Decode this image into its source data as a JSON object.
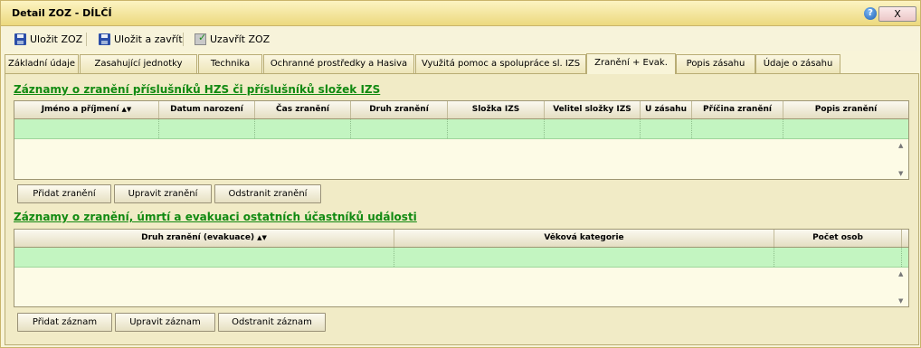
{
  "window": {
    "title": "Detail ZOZ - DÍLČÍ",
    "help_glyph": "?",
    "close_label": "X"
  },
  "toolbar": {
    "save_label": "Uložit ZOZ",
    "save_close_label": "Uložit a zavřít",
    "close_zoz_label": "Uzavřít ZOZ"
  },
  "tabs": [
    {
      "label": "Základní údaje"
    },
    {
      "label": "Zasahující jednotky"
    },
    {
      "label": "Technika"
    },
    {
      "label": "Ochranné prostředky a Hasiva"
    },
    {
      "label": "Využitá pomoc a spolupráce sl. IZS"
    },
    {
      "label": "Zranění + Evak."
    },
    {
      "label": "Popis zásahu"
    },
    {
      "label": "Údaje o zásahu"
    }
  ],
  "active_tab": "Zranění + Evak.",
  "section1": {
    "title": "Záznamy o zranění příslušníků HZS či příslušníků složek IZS",
    "columns": [
      "Jméno a příjmení",
      "Datum narození",
      "Čas zranění",
      "Druh zranění",
      "Složka IZS",
      "Velitel složky IZS",
      "U zásahu",
      "Příčina zranění",
      "Popis zranění"
    ],
    "buttons": {
      "add": "Přidat zranění",
      "edit": "Upravit zranění",
      "remove": "Odstranit zranění"
    }
  },
  "section2": {
    "title": "Záznamy o zranění, úmrtí a evakuaci ostatních účastníků události",
    "columns": [
      "Druh zranění (evakuace)",
      "Věková kategorie",
      "Počet osob"
    ],
    "buttons": {
      "add": "Přidat záznam",
      "edit": "Upravit záznam",
      "remove": "Odstranit záznam"
    }
  },
  "colors": {
    "section_title": "#118a11",
    "selected_row": "#c3f5c1",
    "panel_bg": "#f1ebc6"
  },
  "icons": {
    "sort": "sort-ascending-icon",
    "save": "floppy-disk-icon",
    "close_zoz": "close-document-icon",
    "help": "help-icon"
  }
}
